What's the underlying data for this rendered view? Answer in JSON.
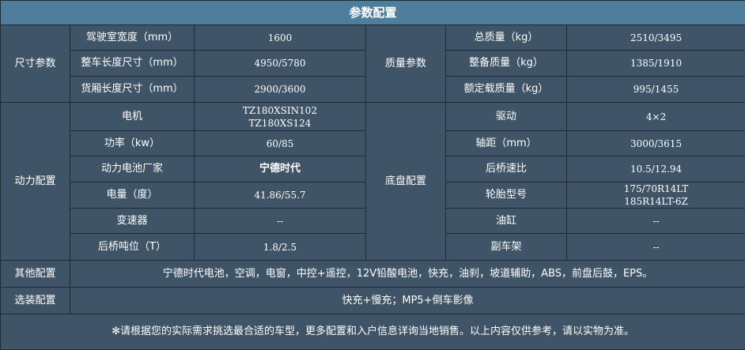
{
  "title": "参数配置",
  "size": {
    "group": "尺寸参数",
    "rows": [
      {
        "label": "驾驶室宽度（mm）",
        "value": "1600"
      },
      {
        "label": "整车长度尺寸（mm）",
        "value": "4950/5780"
      },
      {
        "label": "货厢长度尺寸（mm）",
        "value": "2900/3600"
      }
    ]
  },
  "mass": {
    "group": "质量参数",
    "rows": [
      {
        "label": "总质量（kg）",
        "value": "2510/3495"
      },
      {
        "label": "整备质量（kg）",
        "value": "1385/1910"
      },
      {
        "label": "额定载质量（kg）",
        "value": "995/1455"
      }
    ]
  },
  "power": {
    "group": "动力配置",
    "rows": [
      {
        "label": "电机",
        "value_lines": [
          "TZ180XSIN102",
          "TZ180XS124"
        ]
      },
      {
        "label": "功率（kw）",
        "value": "60/85"
      },
      {
        "label": "动力电池厂家",
        "value": "宁德时代"
      },
      {
        "label": "电量（度）",
        "value": "41.86/55.7"
      },
      {
        "label": "变速器",
        "value": "--"
      },
      {
        "label": "后桥吨位（T）",
        "value": "1.8/2.5"
      }
    ]
  },
  "chassis": {
    "group": "底盘配置",
    "rows": [
      {
        "label": "驱动",
        "value": "4×2"
      },
      {
        "label": "轴距（mm）",
        "value": "3000/3615"
      },
      {
        "label": "后桥速比",
        "value": "10.5/12.94"
      },
      {
        "label": "轮胎型号",
        "value_lines": [
          "175/70R14LT",
          "185R14LT-6Z"
        ]
      },
      {
        "label": "油缸",
        "value": "--"
      },
      {
        "label": "副车架",
        "value": "--"
      }
    ]
  },
  "other": {
    "label": "其他配置",
    "value": "宁德时代电池，空调，电窗，中控+遥控，12V铅酸电池，快充，油刹，坡道辅助，ABS，前盘后鼓，EPS。"
  },
  "optional": {
    "label": "选装配置",
    "value": "快充+慢充；MP5+倒车影像"
  },
  "footnote": "✻请根据您的实际需求挑选最合适的车型，更多配置和入户信息详询当地销售。以上内容仅供参考，请以实物为准。"
}
